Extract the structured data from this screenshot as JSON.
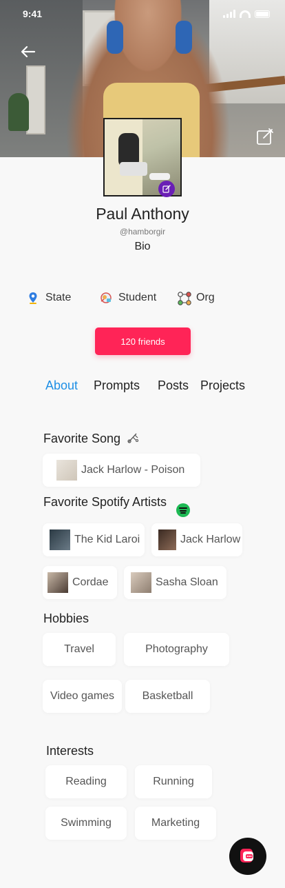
{
  "status_bar": {
    "time": "9:41"
  },
  "profile": {
    "name": "Paul Anthony",
    "handle": "@hamborgir",
    "bio": "Bio",
    "meta": [
      {
        "icon": "location-pin-icon",
        "label": "State"
      },
      {
        "icon": "student-badge-icon",
        "label": "Student"
      },
      {
        "icon": "org-network-icon",
        "label": "Org"
      }
    ],
    "friends_button": "120 friends"
  },
  "tabs": [
    {
      "label": "About",
      "active": true
    },
    {
      "label": "Prompts",
      "active": false
    },
    {
      "label": "Posts",
      "active": false
    },
    {
      "label": "Projects",
      "active": false
    }
  ],
  "about": {
    "favorite_song": {
      "title": "Favorite Song",
      "song": "Jack Harlow - Poison"
    },
    "favorite_artists": {
      "title": "Favorite Spotify Artists",
      "artists": [
        "The Kid Laroi",
        "Jack Harlow",
        "Cordae",
        "Sasha Sloan"
      ]
    },
    "hobbies": {
      "title": "Hobbies",
      "items": [
        "Travel",
        "Photography",
        "Video games",
        "Basketball"
      ]
    },
    "interests": {
      "title": "Interests",
      "items": [
        "Reading",
        "Running",
        "Swimming",
        "Marketing"
      ]
    }
  },
  "colors": {
    "accent_pink": "#ff2457",
    "active_tab": "#1e8fe5",
    "avatar_edit_badge": "#6a1fb5",
    "spotify_green": "#1db954"
  }
}
